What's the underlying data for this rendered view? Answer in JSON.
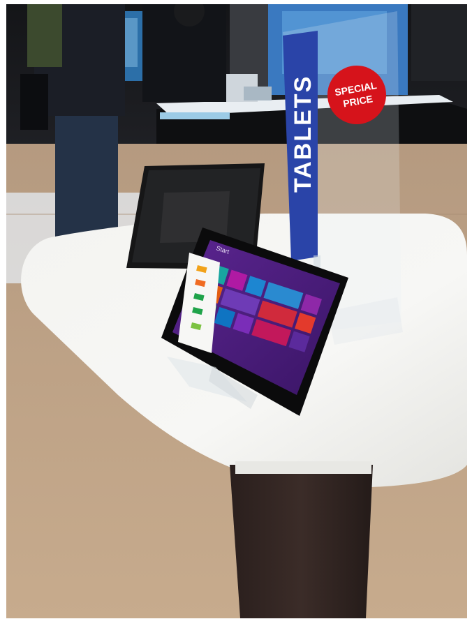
{
  "photo": {
    "sign": {
      "label": "TABLETS",
      "color": "#2a44a8"
    },
    "badge": {
      "line1": "SPECIAL",
      "line2": "PRICE",
      "color": "#d6131b"
    },
    "tablet_screen": {
      "start_label": "Start",
      "background": "#4b1c7c"
    }
  }
}
